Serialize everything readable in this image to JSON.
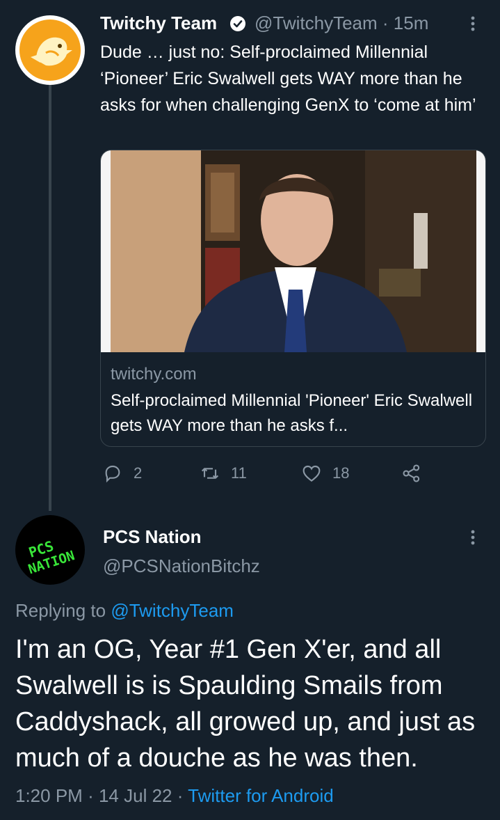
{
  "tweet1": {
    "name": "Twitchy Team",
    "handle": "@TwitchyTeam",
    "separator": "·",
    "time": "15m",
    "text": "Dude … just no: Self-proclaimed Millennial ‘Pioneer’ Eric Swalwell gets WAY more than he asks for when challenging GenX to ‘come at him’",
    "card": {
      "domain": "twitchy.com",
      "title": "Self-proclaimed Millennial 'Pioneer' Eric Swalwell gets WAY more than he asks f..."
    },
    "actions": {
      "replies": "2",
      "retweets": "11",
      "likes": "18"
    },
    "icons": [
      "verified-icon",
      "more-icon",
      "reply-icon",
      "retweet-icon",
      "like-icon",
      "share-icon"
    ]
  },
  "tweet2": {
    "name": "PCS Nation",
    "handle": "@PCSNationBitchz",
    "avatar_text_1": "PCS",
    "avatar_text_2": "NATION",
    "replying_prefix": "Replying to",
    "replying_to": "@TwitchyTeam",
    "text": "I'm an OG, Year #1 Gen X'er, and all Swalwell is is Spaulding Smails from Caddyshack, all growed up, and just as much of a douche as he was then.",
    "time": "1:20 PM",
    "separator": "·",
    "date": "14 Jul 22",
    "source": "Twitter for Android"
  },
  "colors": {
    "background": "#15202b",
    "secondary_text": "#8b98a5",
    "link": "#1d9bf0",
    "border": "#38444d",
    "avatar_text_green": "#39e639"
  }
}
